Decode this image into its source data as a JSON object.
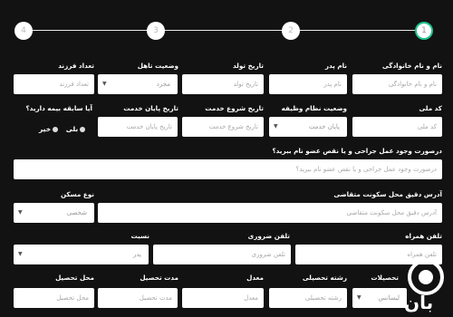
{
  "stepper": {
    "steps": [
      "1",
      "2",
      "3",
      "4"
    ],
    "active_step": "1"
  },
  "row1": {
    "name_label": "نام و نام خانوادگی",
    "name_placeholder": "نام و نام خانوادگی",
    "father_label": "نام پدر",
    "father_placeholder": "نام پدر",
    "birth_label": "تاریخ تولد",
    "birth_placeholder": "تاریخ تولد",
    "marital_label": "وضعیت تاهل",
    "marital_value": "مجرد",
    "children_label": "تعداد فرزند",
    "children_placeholder": "تعداد فرزند"
  },
  "row2": {
    "national_label": "کد ملی",
    "national_placeholder": "کد ملی",
    "military_label": "وضعیت نظام وظیفه",
    "military_value": "پایان خدمت",
    "service_start_label": "تاریخ شروع خدمت",
    "service_start_placeholder": "تاریخ شروع خدمت",
    "service_end_label": "تاریخ پایان خدمت",
    "service_end_placeholder": "تاریخ پایان خدمت",
    "record_question": "آیا سابقه بیمه دارید؟",
    "record_yes": "بلی",
    "record_no": "خیر"
  },
  "row3": {
    "surgery_label": "درصورت وجود عمل جراحی و یا نقص عضو نام ببرید؟",
    "surgery_placeholder": "درصورت وجود عمل جراحی و یا نقص عضو نام ببرید؟"
  },
  "row4": {
    "address_label": "آدرس دقیق محل سکونت متقاضی",
    "address_placeholder": "آدرس دقیق محل سکونت متقاضی",
    "housing_label": "نوع مسکن",
    "housing_value": "شخصی"
  },
  "row5": {
    "mobile_label": "تلفن همراه",
    "mobile_placeholder": "تلفن همراه",
    "emergency_label": "تلفن ضروری",
    "emergency_placeholder": "تلفن ضروری",
    "relation_label": "نسبت",
    "relation_value": "پدر"
  },
  "row6": {
    "degree_label": "تحصیلات",
    "degree_value": "لیسانس",
    "field_label": "رشته تحصیلی",
    "field_placeholder": "رشته تحصیلی",
    "gpa_label": "معدل",
    "gpa_placeholder": "معدل",
    "duration_label": "مدت تحصیل",
    "duration_placeholder": "مدت تحصیل",
    "place_label": "محل تحصیل",
    "place_placeholder": "محل تحصیل"
  },
  "watermark": {
    "text": "بان"
  }
}
